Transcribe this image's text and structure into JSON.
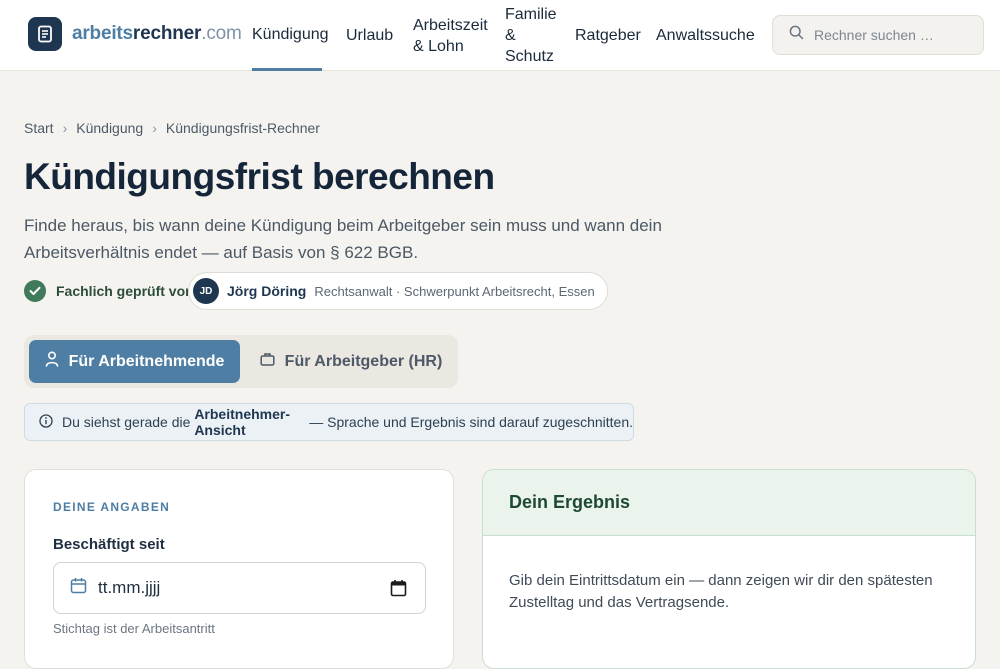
{
  "header": {
    "logo": {
      "part1": "arbeits",
      "part2": "rechner",
      "part3": ".com"
    },
    "nav": [
      {
        "label": "Kündigung",
        "active": true
      },
      {
        "label": "Urlaub",
        "active": false
      },
      {
        "label": "Arbeitszeit & Lohn",
        "active": false
      },
      {
        "label": "Familie & Schutz",
        "active": false
      },
      {
        "label": "Ratgeber",
        "active": false
      },
      {
        "label": "Anwaltssuche",
        "active": false
      }
    ],
    "search": {
      "placeholder": "Rechner suchen …"
    }
  },
  "breadcrumb": [
    "Start",
    "Kündigung",
    "Kündigungsfrist-Rechner"
  ],
  "breadcrumb_separator": "›",
  "page": {
    "title": "Kündigungsfrist berechnen",
    "lead": "Finde heraus, bis wann deine Kündigung beim Arbeitgeber sein muss und wann dein Arbeitsverhältnis endet — auf Basis von § 622 BGB."
  },
  "review": {
    "label": "Fachlich geprüft von",
    "initials": "JD",
    "name": "Jörg Döring",
    "role": "Rechtsanwalt · Schwerpunkt Arbeitsrecht, Essen"
  },
  "toggle": {
    "employee": "Für Arbeitnehmende",
    "employer": "Für Arbeitgeber (HR)",
    "selected": "employee"
  },
  "info": {
    "prefix": "Du siehst gerade die ",
    "highlight": "Arbeitnehmer-Ansicht",
    "suffix": " — Sprache und Ergebnis sind darauf zugeschnitten."
  },
  "form": {
    "section_label": "DEINE ANGABEN",
    "start_label": "Beschäftigt seit",
    "start_value": "tt.mm.jjjj",
    "partial_hint": "Stichtag ist der Arbeitsantritt"
  },
  "result": {
    "title": "Dein Ergebnis",
    "text": "Gib dein Eintrittsdatum ein — dann zeigen wir dir den spätesten Zustelltag und das Vertragsende."
  },
  "colors": {
    "brand_dark": "#1e3650",
    "accent_blue": "#4e7ea3",
    "success_green": "#3f7a5a",
    "background": "#f5f3ef"
  }
}
